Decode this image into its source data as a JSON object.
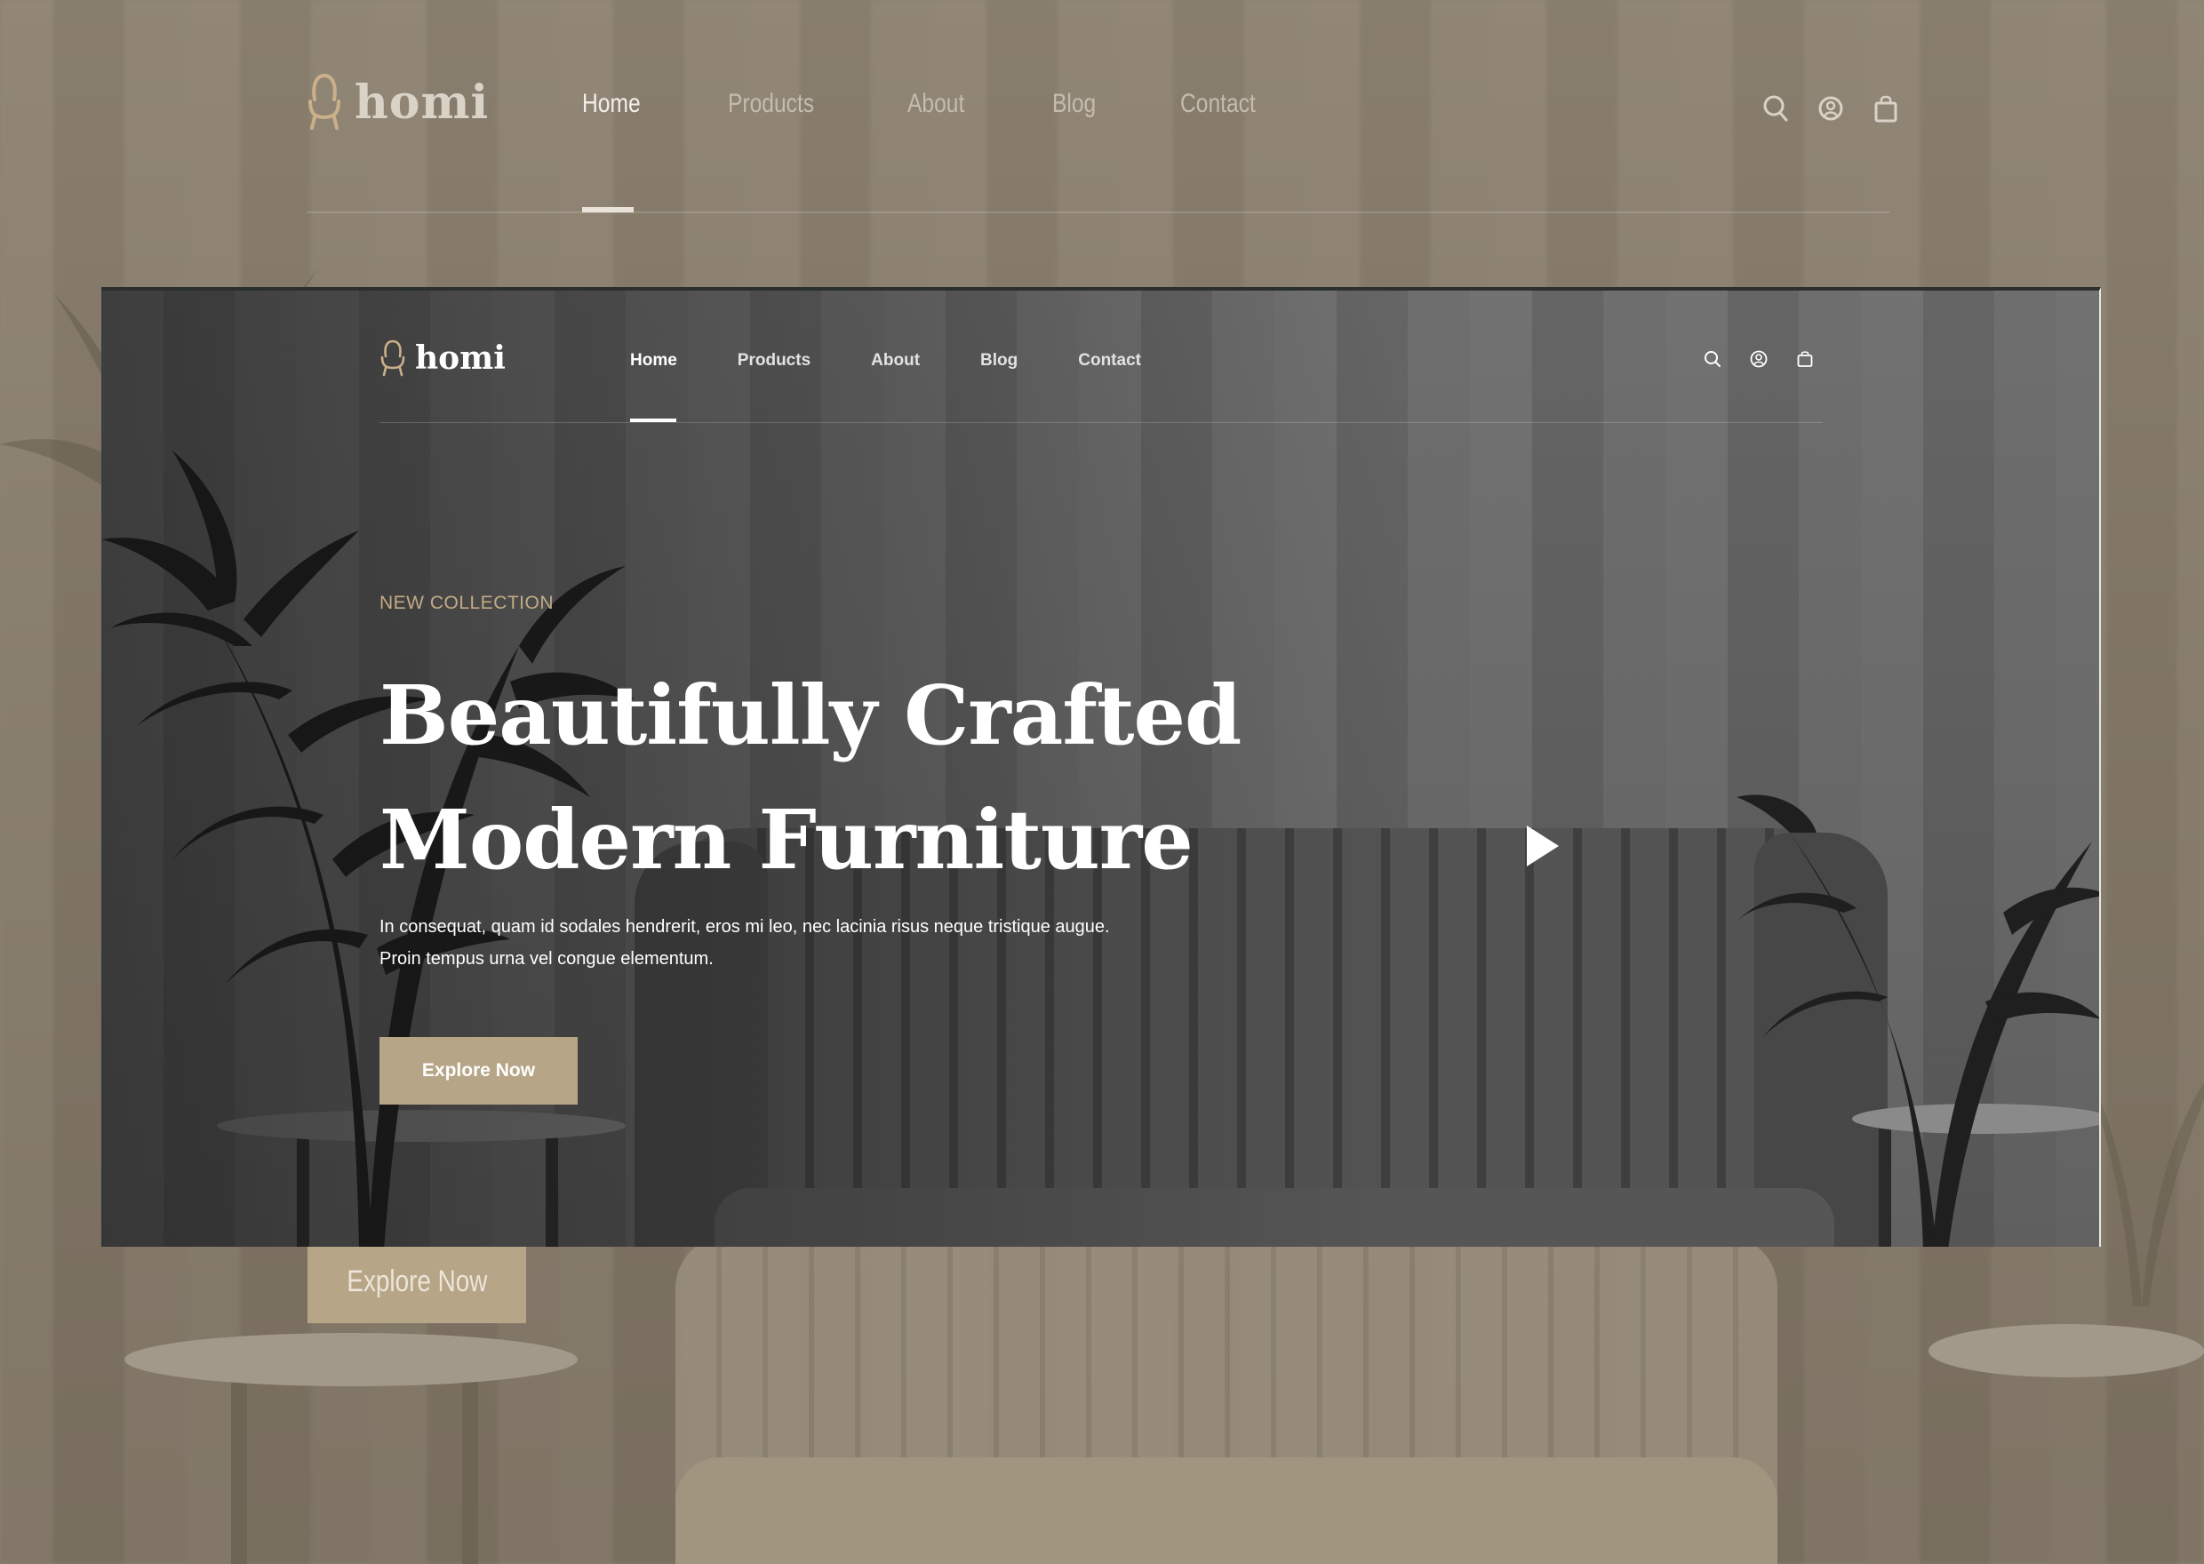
{
  "background": {
    "logo_text": "homi",
    "nav": [
      "Home",
      "Products",
      "About",
      "Blog",
      "Contact"
    ],
    "cta_label": "Explore Now"
  },
  "header": {
    "logo_text": "homi",
    "nav": [
      {
        "label": "Home",
        "active": true
      },
      {
        "label": "Products",
        "active": false
      },
      {
        "label": "About",
        "active": false
      },
      {
        "label": "Blog",
        "active": false
      },
      {
        "label": "Contact",
        "active": false
      }
    ],
    "icons": [
      "search-icon",
      "user-icon",
      "shopping-bag-icon"
    ]
  },
  "hero": {
    "eyebrow": "NEW COLLECTION",
    "title_line1": "Beautifully Crafted",
    "title_line2": "Modern Furniture",
    "description_line1": "In consequat, quam id sodales hendrerit, eros mi leo, nec lacinia risus neque tristique augue.",
    "description_line2": "Proin tempus urna vel congue elementum.",
    "cta_label": "Explore Now",
    "play_icon": "play-icon"
  },
  "colors": {
    "accent": "#b7a587",
    "eyebrow": "#c3ab86",
    "background_tint": "#8b8070",
    "text": "#ffffff"
  }
}
